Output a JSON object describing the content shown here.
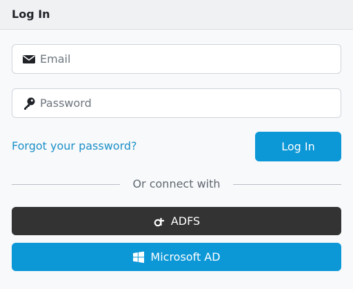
{
  "header": {
    "title": "Log In"
  },
  "form": {
    "email": {
      "placeholder": "Email",
      "value": "",
      "icon": "envelope-icon"
    },
    "password": {
      "placeholder": "Password",
      "value": "",
      "icon": "key-icon"
    },
    "forgot_label": "Forgot your password?",
    "login_label": "Log In"
  },
  "divider": {
    "text": "Or connect with"
  },
  "sso": {
    "adfs": {
      "label": "ADFS",
      "icon": "adfs-icon",
      "color": "#333333"
    },
    "microsoft": {
      "label": "Microsoft AD",
      "icon": "windows-icon",
      "color": "#0c97d7"
    }
  },
  "colors": {
    "accent": "#0c97d7",
    "link": "#1a8fc9"
  }
}
